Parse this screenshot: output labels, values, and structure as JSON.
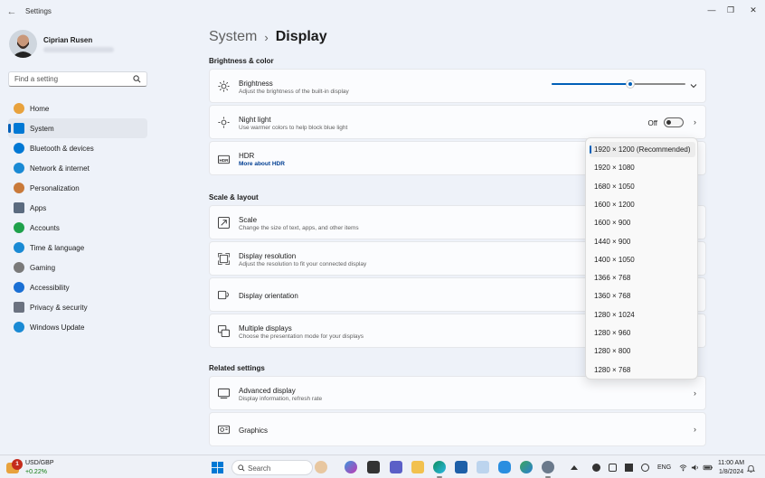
{
  "window": {
    "title": "Settings",
    "back": "←",
    "minimize": "—",
    "maximize": "❐",
    "close": "✕"
  },
  "profile": {
    "name": "Ciprian Rusen"
  },
  "search": {
    "placeholder": "Find a setting"
  },
  "nav": [
    {
      "label": "Home",
      "icon": "home-icon",
      "color": "#e8a23d"
    },
    {
      "label": "System",
      "icon": "system-icon",
      "color": "#0078d4",
      "active": true
    },
    {
      "label": "Bluetooth & devices",
      "icon": "bluetooth-icon",
      "color": "#0078d4"
    },
    {
      "label": "Network & internet",
      "icon": "network-icon",
      "color": "#1a8ad4"
    },
    {
      "label": "Personalization",
      "icon": "brush-icon",
      "color": "#c97a3a"
    },
    {
      "label": "Apps",
      "icon": "apps-icon",
      "color": "#5b6b7f"
    },
    {
      "label": "Accounts",
      "icon": "accounts-icon",
      "color": "#1fa14b"
    },
    {
      "label": "Time & language",
      "icon": "globe-icon",
      "color": "#1a8ad4"
    },
    {
      "label": "Gaming",
      "icon": "gamepad-icon",
      "color": "#7a7a7a"
    },
    {
      "label": "Accessibility",
      "icon": "accessibility-icon",
      "color": "#1a6fd4"
    },
    {
      "label": "Privacy & security",
      "icon": "shield-icon",
      "color": "#6b7280"
    },
    {
      "label": "Windows Update",
      "icon": "update-icon",
      "color": "#1a8ad4"
    }
  ],
  "breadcrumb": {
    "parent": "System",
    "separator": "›",
    "current": "Display"
  },
  "sections": {
    "brightness_color": "Brightness & color",
    "scale_layout": "Scale & layout",
    "related": "Related settings"
  },
  "cards": {
    "brightness": {
      "title": "Brightness",
      "subtitle": "Adjust the brightness of the built-in display",
      "value_fraction": 0.59
    },
    "night_light": {
      "title": "Night light",
      "subtitle": "Use warmer colors to help block blue light",
      "state": "Off"
    },
    "hdr": {
      "title": "HDR",
      "link": "More about HDR"
    },
    "scale": {
      "title": "Scale",
      "subtitle": "Change the size of text, apps, and other items"
    },
    "resolution": {
      "title": "Display resolution",
      "subtitle": "Adjust the resolution to fit your connected display"
    },
    "orientation": {
      "title": "Display orientation"
    },
    "multiple": {
      "title": "Multiple displays",
      "subtitle": "Choose the presentation mode for your displays"
    },
    "advanced": {
      "title": "Advanced display",
      "subtitle": "Display information, refresh rate"
    },
    "graphics": {
      "title": "Graphics"
    }
  },
  "resolution_options": [
    "1920 × 1200 (Recommended)",
    "1920 × 1080",
    "1680 × 1050",
    "1600 × 1200",
    "1600 × 900",
    "1440 × 900",
    "1400 × 1050",
    "1366 × 768",
    "1360 × 768",
    "1280 × 1024",
    "1280 × 960",
    "1280 × 800",
    "1280 × 768"
  ],
  "taskbar": {
    "widget_title": "USD/GBP",
    "widget_value": "+0.22%",
    "widget_badge": "1",
    "search_label": "Search",
    "lang": "ENG",
    "time": "11:00 AM",
    "date": "1/8/2024"
  }
}
